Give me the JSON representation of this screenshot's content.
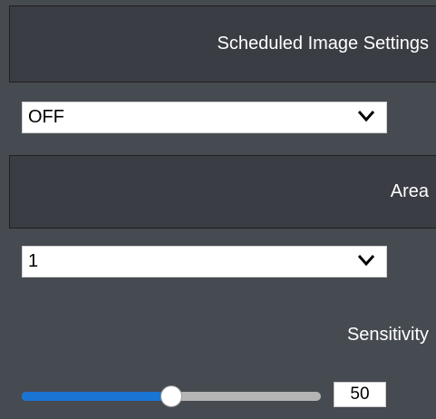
{
  "scheduled_image": {
    "title": "Scheduled Image Settings",
    "mode_select": {
      "value": "OFF",
      "icon": "chevron-down-icon"
    }
  },
  "area": {
    "title": "Area",
    "area_select": {
      "value": "1",
      "icon": "chevron-down-icon"
    }
  },
  "sensitivity": {
    "label": "Sensitivity",
    "value": "50",
    "slider_fraction": 0.5,
    "colors": {
      "fill": "#1a74d4",
      "track": "#b5b5b5"
    }
  },
  "colors": {
    "panel_bg": "#464a51",
    "header_bg": "#3a3d43",
    "text": "#ffffff"
  }
}
